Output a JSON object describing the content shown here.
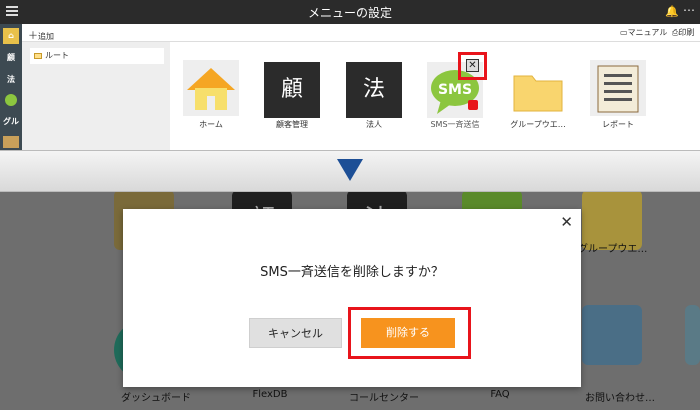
{
  "window": {
    "title": "メニューの設定"
  },
  "sidebar": {
    "items": [
      "顧",
      "法",
      "グル"
    ]
  },
  "toolbar": {
    "add_label": "追加",
    "manual_label": "マニュアル",
    "print_label": "印刷"
  },
  "tree": {
    "root_label": "ルート"
  },
  "menu_icons": [
    {
      "label": "ホーム",
      "icon": "home-icon"
    },
    {
      "label": "顧客管理",
      "icon": "顧"
    },
    {
      "label": "法人",
      "icon": "法"
    },
    {
      "label": "SMS一斉送信",
      "icon": "SMS"
    },
    {
      "label": "グループウエ…",
      "icon": "folder-icon"
    },
    {
      "label": "レポート",
      "icon": "report-icon"
    }
  ],
  "background_icons": {
    "labels": [
      "ダッシュボード",
      "FlexDB",
      "コールセンター",
      "FAQ",
      "お問い合わせ…",
      "グループウエ…"
    ],
    "kanji": [
      "顧",
      "法"
    ],
    "sms": "SMS"
  },
  "dialog": {
    "message": "SMS一斉送信を削除しますか？",
    "cancel_label": "キャンセル",
    "delete_label": "削除する"
  },
  "colors": {
    "accent": "#f7931e",
    "highlight": "#e8141b",
    "titlebar": "#2b2b2b",
    "arrow": "#1d4f96"
  }
}
